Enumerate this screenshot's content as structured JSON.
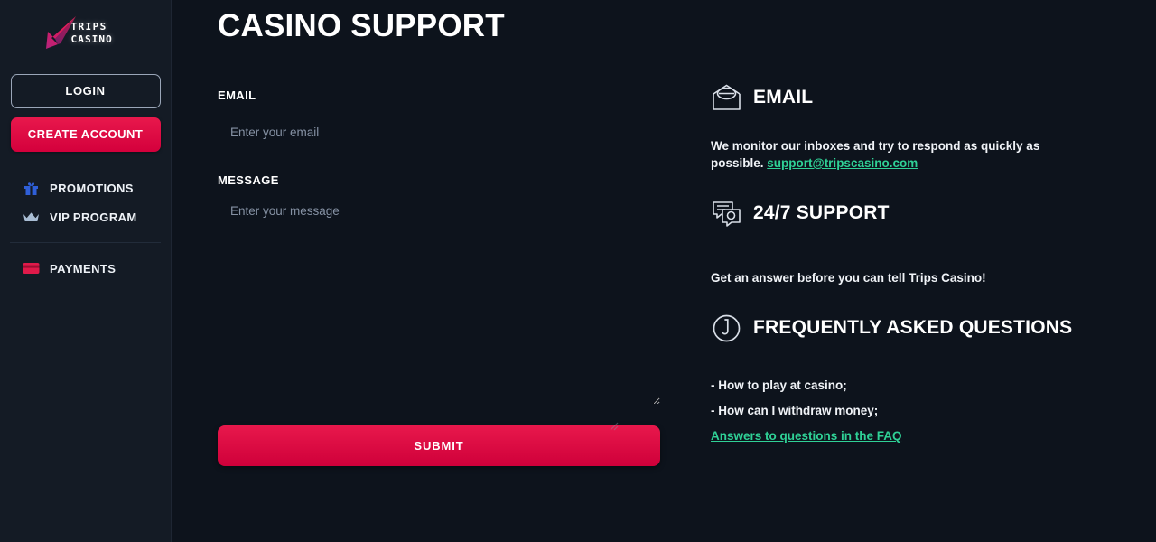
{
  "brand": {
    "name_line1": "TRIPS",
    "name_line2": "CASINO",
    "logo_icon": "arrow-dart-icon",
    "accent_color": "#e8184c",
    "link_color": "#2fd196"
  },
  "sidebar": {
    "login_label": "LOGIN",
    "create_account_label": "CREATE ACCOUNT",
    "items": [
      {
        "label": "PROMOTIONS",
        "icon": "gift-icon",
        "icon_color": "#2f5fd8"
      },
      {
        "label": "VIP PROGRAM",
        "icon": "crown-icon",
        "icon_color": "#a9bdd4"
      },
      {
        "label": "PAYMENTS",
        "icon": "credit-card-icon",
        "icon_color": "#e01a4a"
      }
    ]
  },
  "main": {
    "page_title": "CASINO SUPPORT",
    "form": {
      "email_label": "EMAIL",
      "email_value": "",
      "email_placeholder": "Enter your email",
      "message_label": "MESSAGE",
      "message_value": "",
      "message_placeholder": "Enter your message",
      "submit_label": "SUBMIT"
    }
  },
  "info": {
    "email": {
      "icon": "open-envelope-icon",
      "title": "EMAIL",
      "text_before": "We monitor our inboxes and try to respond as quickly as possible. ",
      "link_text": "support@tripscasino.com"
    },
    "support": {
      "icon": "chat-bubbles-icon",
      "title": "24/7 SUPPORT",
      "text": "Get an answer before you can tell Trips Casino!"
    },
    "faq": {
      "icon": "question-circle-icon",
      "title": "FREQUENTLY ASKED QUESTIONS",
      "items": [
        "- How to play at casino;",
        "- How can I withdraw money;"
      ],
      "link_text": "Answers to questions in the FAQ"
    }
  }
}
